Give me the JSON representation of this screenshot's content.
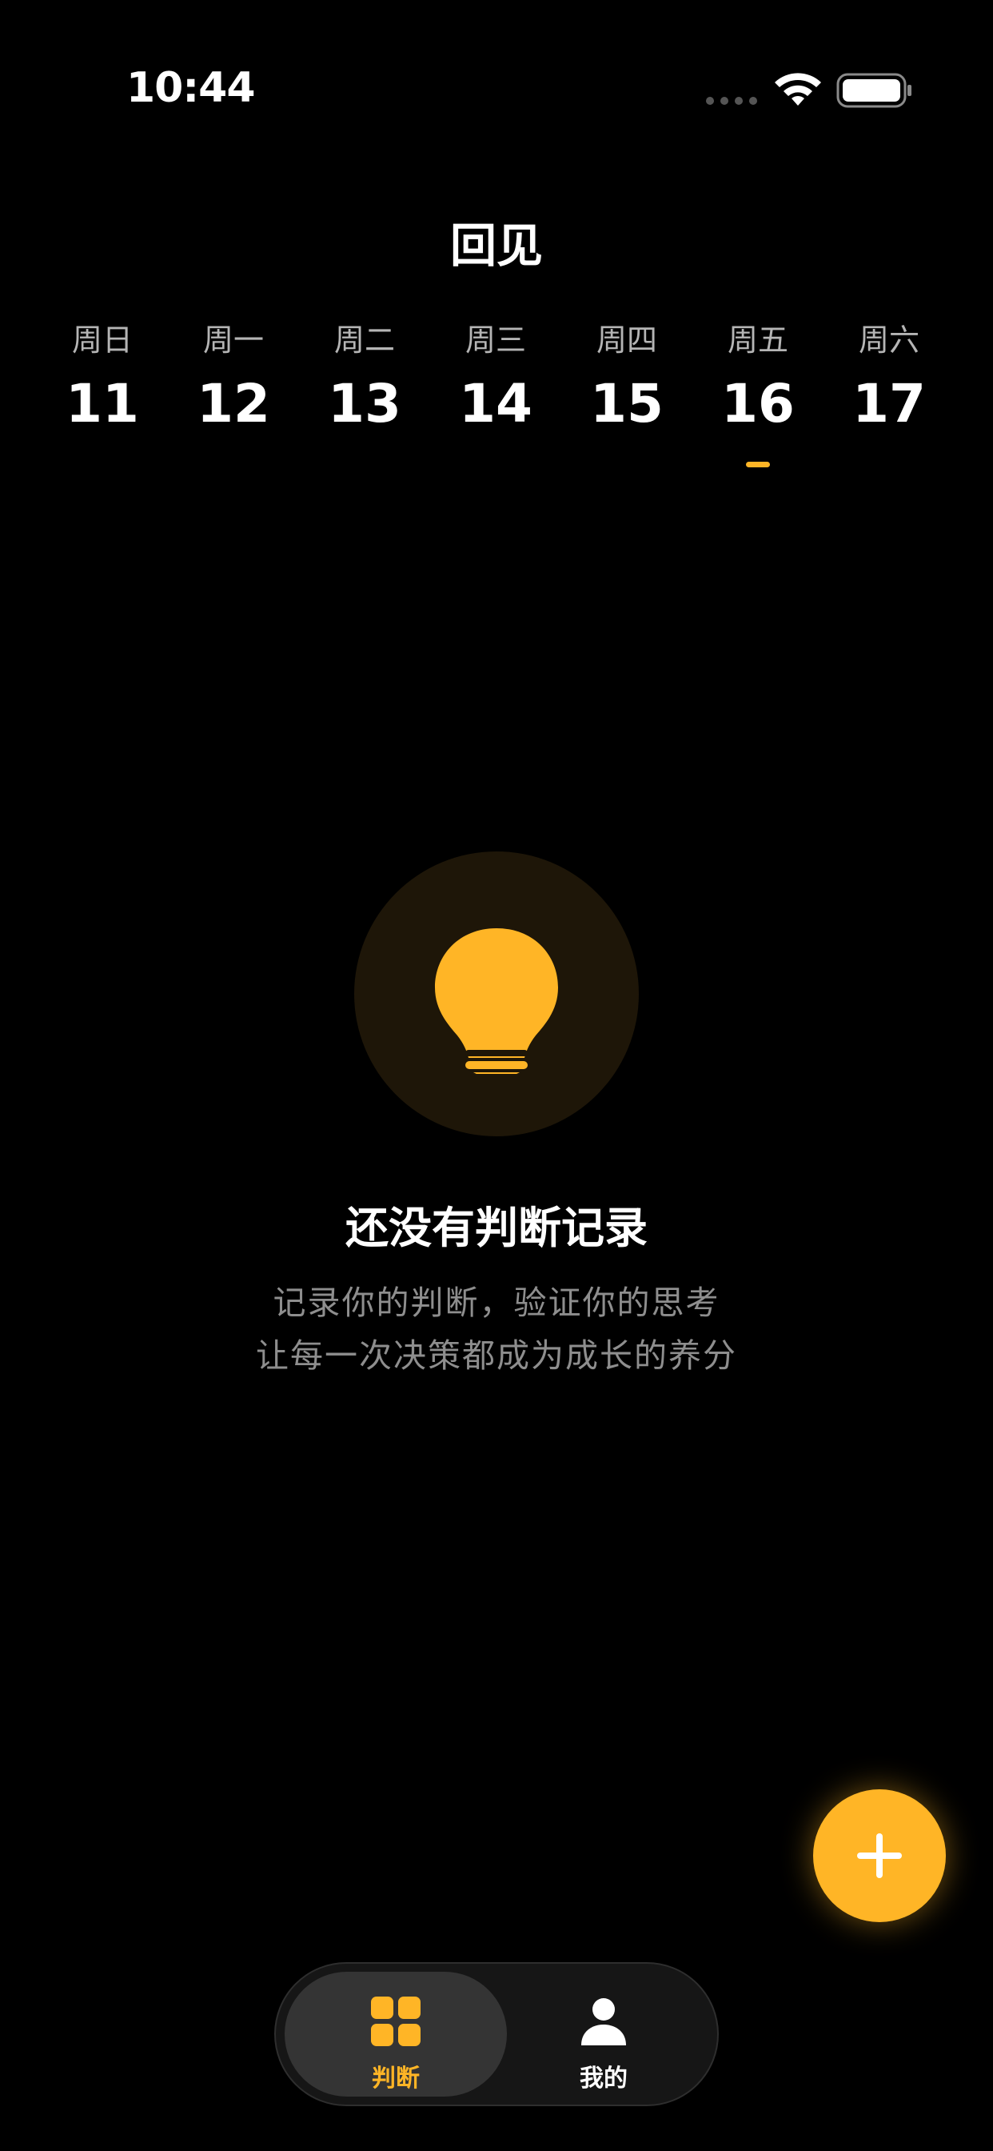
{
  "status_bar": {
    "time": "10:44",
    "icons": [
      "signal-dots-icon",
      "wifi-icon",
      "battery-icon"
    ]
  },
  "header": {
    "title": "回见"
  },
  "week": {
    "days": [
      {
        "label": "周日",
        "date": "11",
        "selected": false
      },
      {
        "label": "周一",
        "date": "12",
        "selected": false
      },
      {
        "label": "周二",
        "date": "13",
        "selected": false
      },
      {
        "label": "周三",
        "date": "14",
        "selected": false
      },
      {
        "label": "周四",
        "date": "15",
        "selected": false
      },
      {
        "label": "周五",
        "date": "16",
        "selected": true
      },
      {
        "label": "周六",
        "date": "17",
        "selected": false
      }
    ]
  },
  "empty_state": {
    "icon": "lightbulb-icon",
    "title": "还没有判断记录",
    "description_line1": "记录你的判断，验证你的思考",
    "description_line2": "让每一次决策都成为成长的养分"
  },
  "fab": {
    "icon": "plus-icon"
  },
  "tab_bar": {
    "tabs": [
      {
        "label": "判断",
        "icon": "grid-icon",
        "active": true
      },
      {
        "label": "我的",
        "icon": "person-icon",
        "active": false
      }
    ]
  },
  "colors": {
    "background": "#000000",
    "accent": "#ffb526",
    "bulb_circle": "#1e1608",
    "secondary_text": "#8e8e8e",
    "tab_bar": "#161616",
    "active_tab": "#343434"
  }
}
